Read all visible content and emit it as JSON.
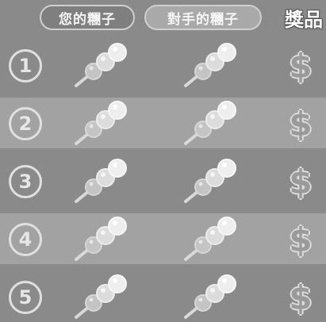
{
  "header": {
    "your_label": "您的糰子",
    "opponent_label": "對手的糰子",
    "prize_label": "獎品"
  },
  "rounds": [
    {
      "number": "1",
      "prize_symbol": "$"
    },
    {
      "number": "2",
      "prize_symbol": "$"
    },
    {
      "number": "3",
      "prize_symbol": "$"
    },
    {
      "number": "4",
      "prize_symbol": "$"
    },
    {
      "number": "5",
      "prize_symbol": "$"
    }
  ],
  "colors": {
    "background_dark": "#8a8a8a",
    "background_light": "#a2a2a2",
    "dango_ball": "#e8e8e8",
    "stick": "#d9d9d9"
  },
  "icons": {
    "dango": "dango-skewer-icon",
    "prize": "dollar-sign-icon"
  }
}
